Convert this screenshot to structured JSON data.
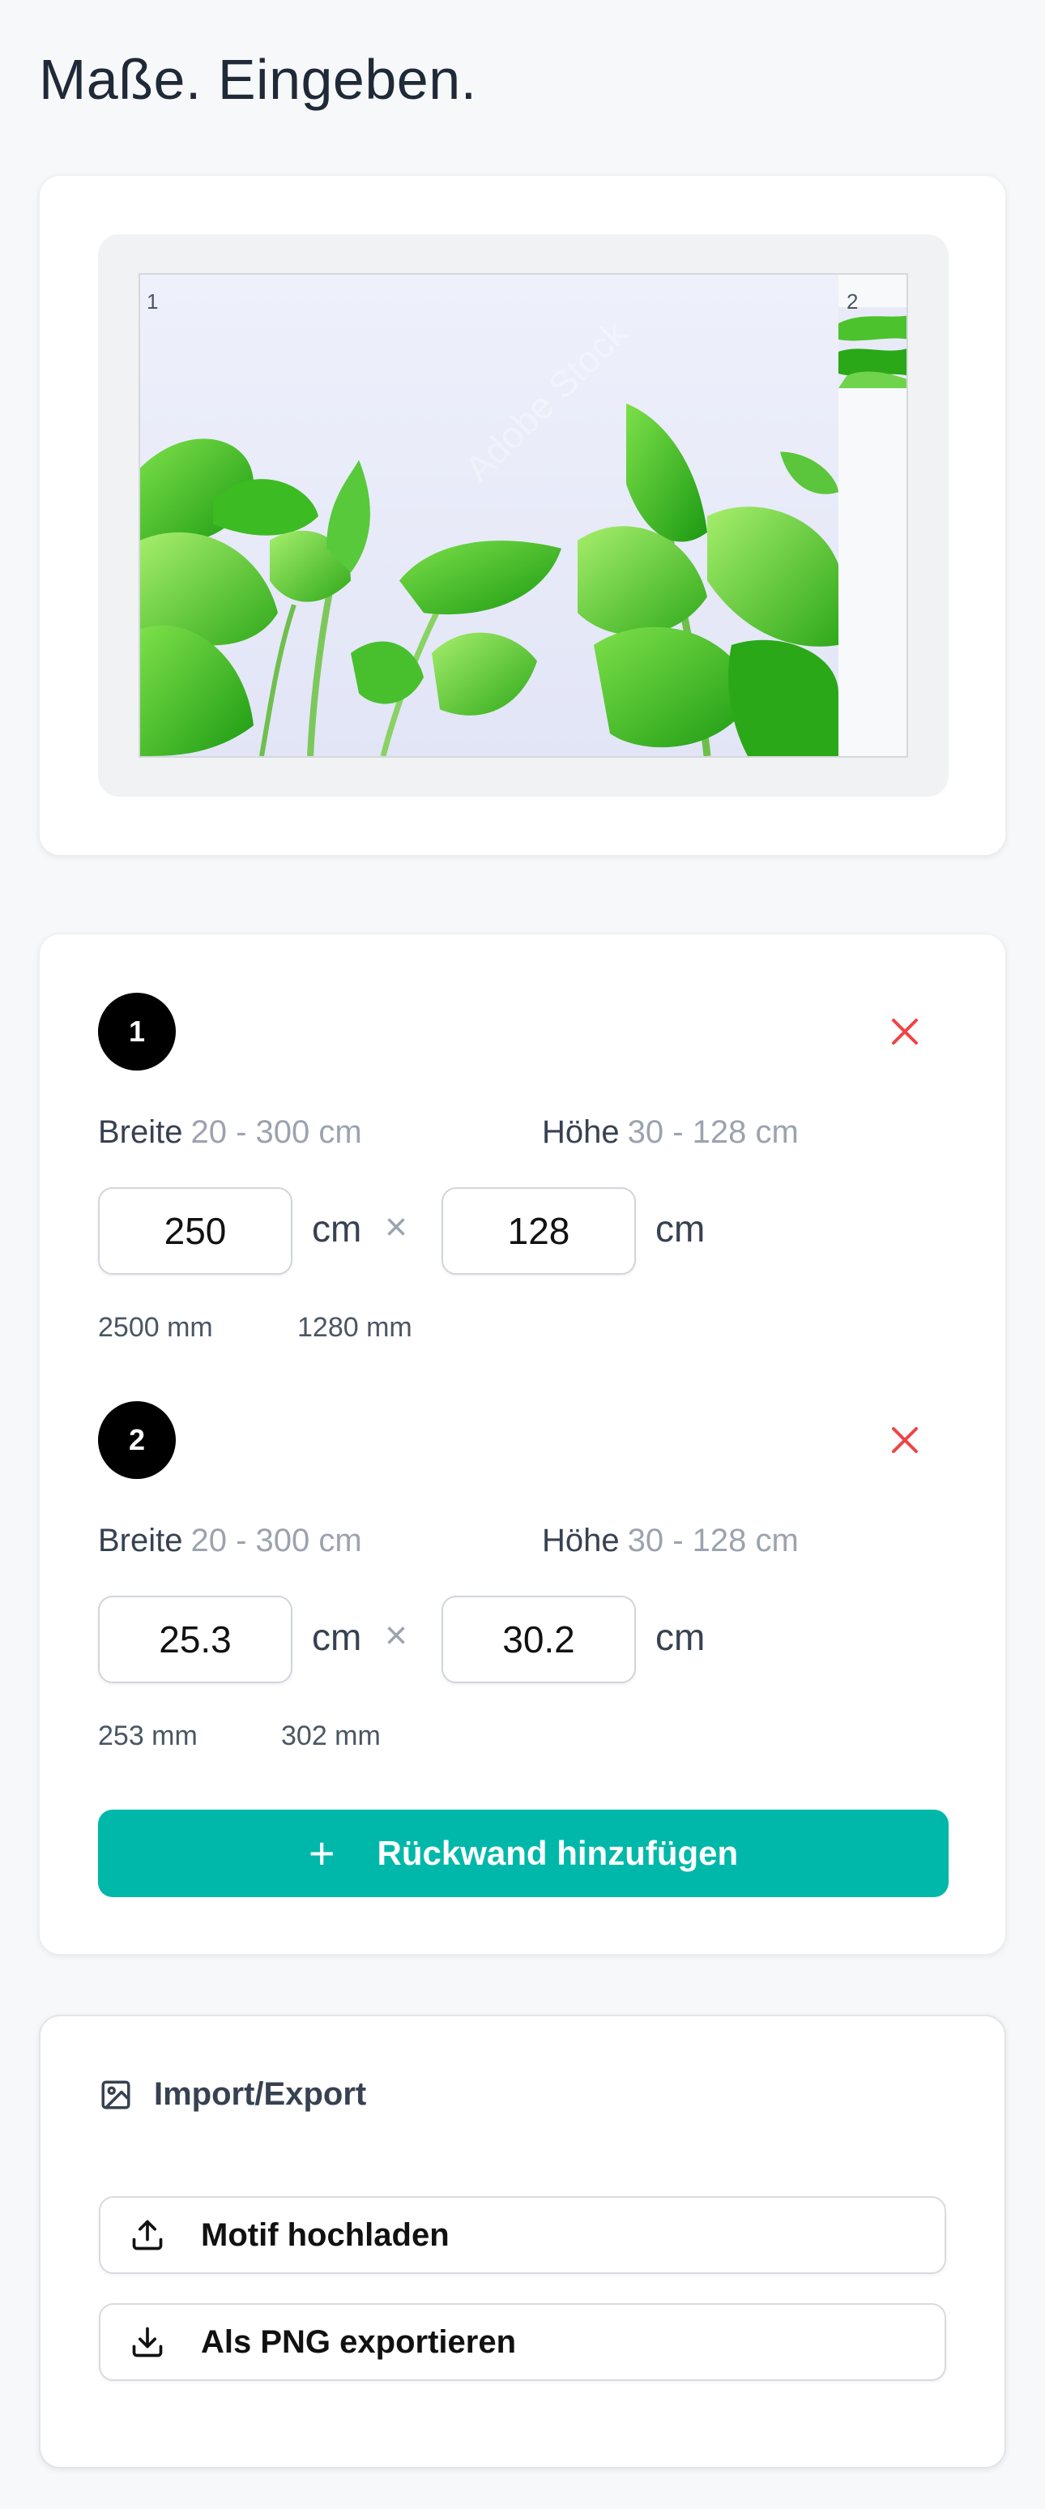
{
  "page": {
    "title": "Maße. Eingeben."
  },
  "preview": {
    "panels": [
      {
        "number": "1"
      },
      {
        "number": "2"
      }
    ],
    "watermark": "Adobe Stock"
  },
  "walls": [
    {
      "number": "1",
      "width_label": "Breite",
      "width_range": "20 - 300 cm",
      "height_label": "Höhe",
      "height_range": "30 - 128 cm",
      "width_value": "250",
      "height_value": "128",
      "unit": "cm",
      "times": "×",
      "width_mm": "2500 mm",
      "height_mm": "1280 mm",
      "remove_icon": "close-icon"
    },
    {
      "number": "2",
      "width_label": "Breite",
      "width_range": "20 - 300 cm",
      "height_label": "Höhe",
      "height_range": "30 - 128 cm",
      "width_value": "25.3",
      "height_value": "30.2",
      "unit": "cm",
      "times": "×",
      "width_mm": "253 mm",
      "height_mm": "302 mm",
      "remove_icon": "close-icon"
    }
  ],
  "add_button": {
    "icon": "plus-icon",
    "label": "Rückwand hinzufügen"
  },
  "import_export": {
    "title": "Import/Export",
    "title_icon": "image-icon",
    "upload": {
      "icon": "upload-icon",
      "label": "Motif hochladen"
    },
    "export": {
      "icon": "download-icon",
      "label": "Als PNG exportieren"
    }
  },
  "colors": {
    "accent": "#00b8a9",
    "remove": "#ef4444",
    "badge": "#000000",
    "background": "#f7f8fa"
  }
}
